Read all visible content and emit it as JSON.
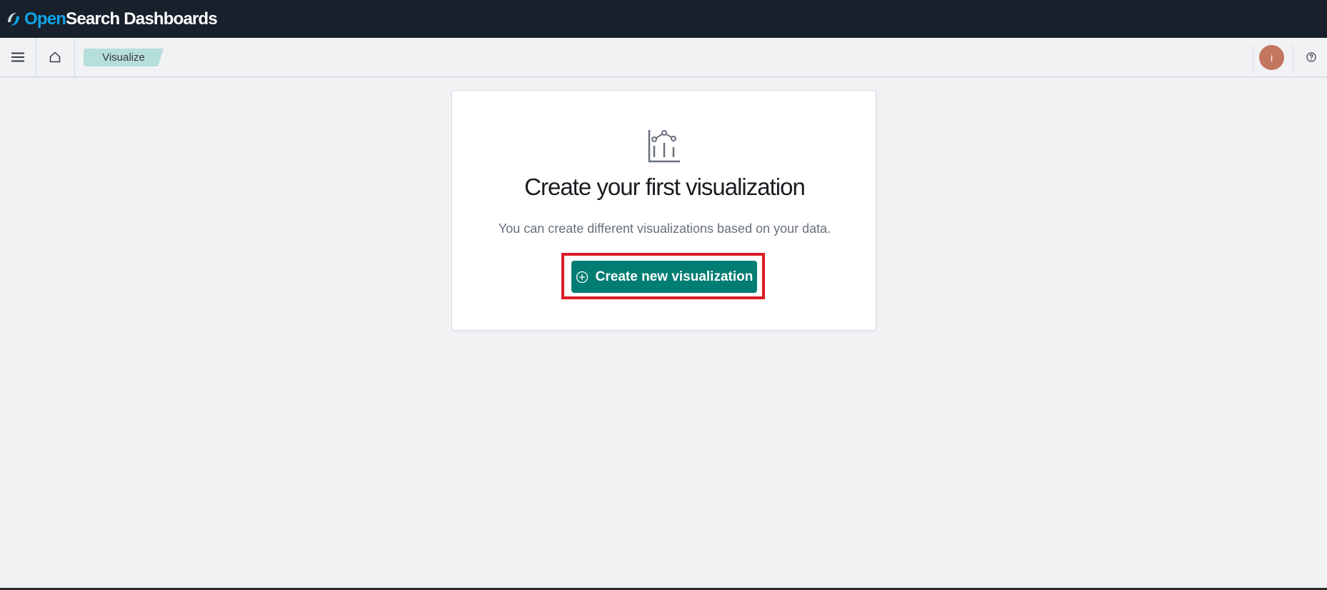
{
  "brand": {
    "name_part1": "Open",
    "name_part2": "Search Dashboards",
    "color_primary": "#0fa4e8",
    "color_text": "#ffffff"
  },
  "header": {
    "menu_icon": "hamburger-icon",
    "home_icon": "home-icon",
    "breadcrumb": "Visualize",
    "avatar_initial": "i",
    "help_icon": "help-icon"
  },
  "empty_state": {
    "icon": "visualize-app-icon",
    "title": "Create your first visualization",
    "description": "You can create different visualizations based on your data.",
    "button_label": "Create new visualization",
    "button_icon": "plus-in-circle-icon",
    "button_color": "#017d73",
    "highlight_color": "#de1a26"
  },
  "colors": {
    "topbar_bg": "#17202b",
    "page_bg": "#f1f2f4",
    "breadcrumb_bg": "#b6dedb",
    "avatar_bg": "#c4765f"
  }
}
